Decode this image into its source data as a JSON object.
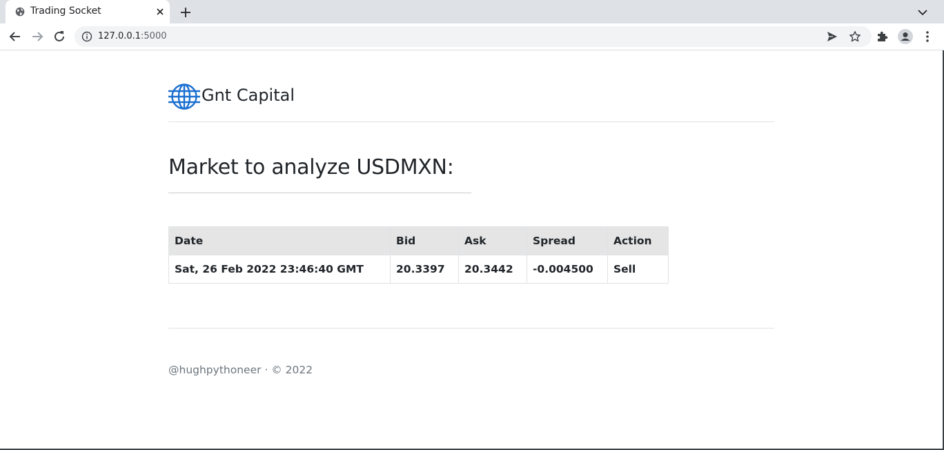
{
  "browser": {
    "tab_title": "Trading Socket",
    "url_host": "127.0.0.1",
    "url_port": ":5000",
    "icons": [
      "globe-icon",
      "close-icon",
      "plus-icon",
      "chevron-down-icon",
      "back-arrow-icon",
      "forward-arrow-icon",
      "reload-icon",
      "info-icon",
      "send-icon",
      "star-icon",
      "puzzle-icon",
      "profile-icon",
      "kebab-menu-icon"
    ]
  },
  "brand": {
    "name": "Gnt Capital",
    "logo_color": "#1a6fcf"
  },
  "main": {
    "heading": "Market to analyze USDMXN:"
  },
  "table": {
    "headers": [
      "Date",
      "Bid",
      "Ask",
      "Spread",
      "Action"
    ],
    "rows": [
      [
        "Sat, 26 Feb 2022 23:46:40 GMT",
        "20.3397",
        "20.3442",
        "-0.004500",
        "Sell"
      ]
    ]
  },
  "footer": {
    "text": "@hughpythoneer · © 2022"
  }
}
